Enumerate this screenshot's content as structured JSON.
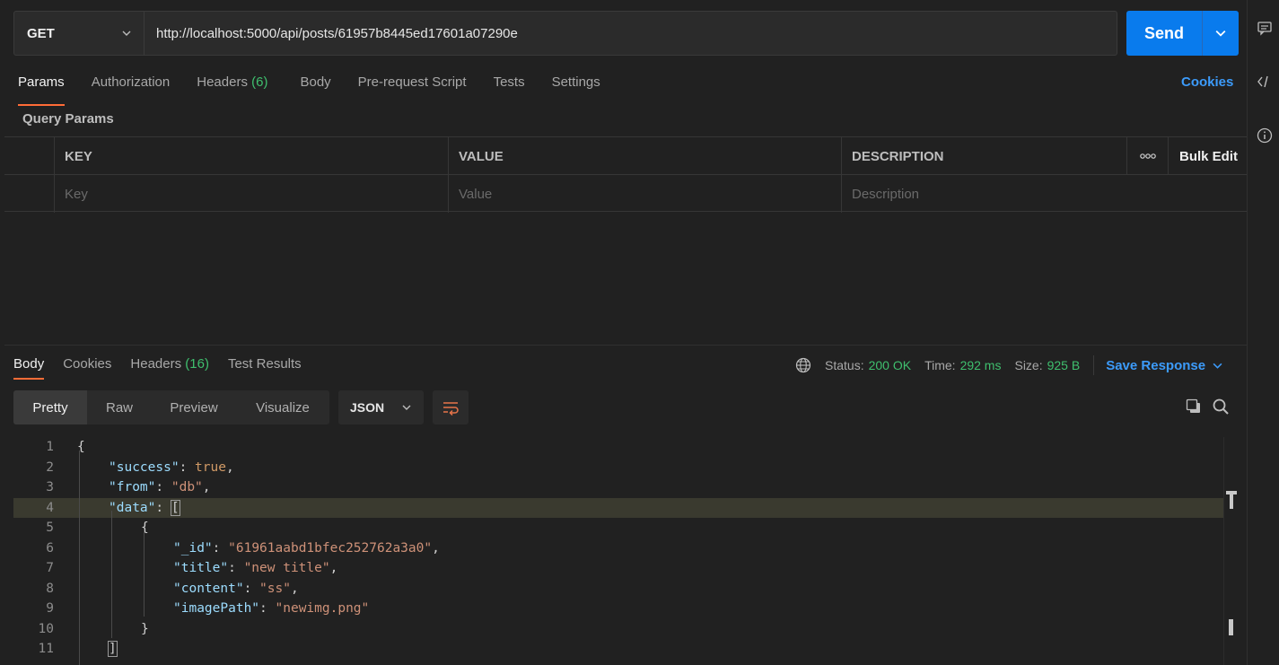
{
  "request": {
    "method": "GET",
    "url": "http://localhost:5000/api/posts/61957b8445ed17601a07290e",
    "send_label": "Send"
  },
  "request_tabs": [
    {
      "label": "Params",
      "count": ""
    },
    {
      "label": "Authorization",
      "count": ""
    },
    {
      "label": "Headers",
      "count": "(6)"
    },
    {
      "label": "Body",
      "count": ""
    },
    {
      "label": "Pre-request Script",
      "count": ""
    },
    {
      "label": "Tests",
      "count": ""
    },
    {
      "label": "Settings",
      "count": ""
    }
  ],
  "cookies_label": "Cookies",
  "query_params": {
    "title": "Query Params",
    "headers": {
      "key": "KEY",
      "value": "VALUE",
      "description": "DESCRIPTION",
      "more": "ooo",
      "bulk_edit": "Bulk Edit"
    },
    "placeholders": {
      "key": "Key",
      "value": "Value",
      "description": "Description"
    }
  },
  "response_tabs": [
    {
      "label": "Body",
      "count": ""
    },
    {
      "label": "Cookies",
      "count": ""
    },
    {
      "label": "Headers",
      "count": "(16)"
    },
    {
      "label": "Test Results",
      "count": ""
    }
  ],
  "status": {
    "status_label": "Status:",
    "status_value": "200 OK",
    "time_label": "Time:",
    "time_value": "292 ms",
    "size_label": "Size:",
    "size_value": "925 B",
    "save_response": "Save Response"
  },
  "format_options": [
    "Pretty",
    "Raw",
    "Preview",
    "Visualize"
  ],
  "language": "JSON",
  "code_lines": [
    {
      "n": "1"
    },
    {
      "n": "2"
    },
    {
      "n": "3"
    },
    {
      "n": "4"
    },
    {
      "n": "5"
    },
    {
      "n": "6"
    },
    {
      "n": "7"
    },
    {
      "n": "8"
    },
    {
      "n": "9"
    },
    {
      "n": "10"
    },
    {
      "n": "11"
    }
  ],
  "json_body": {
    "success_key": "\"success\"",
    "success_val": "true",
    "from_key": "\"from\"",
    "from_val": "\"db\"",
    "data_key": "\"data\"",
    "id_key": "\"_id\"",
    "id_val": "\"61961aabd1bfec252762a3a0\"",
    "title_key": "\"title\"",
    "title_val": "\"new title\"",
    "content_key": "\"content\"",
    "content_val": "\"ss\"",
    "image_key": "\"imagePath\"",
    "image_val": "\"newimg.png\""
  }
}
